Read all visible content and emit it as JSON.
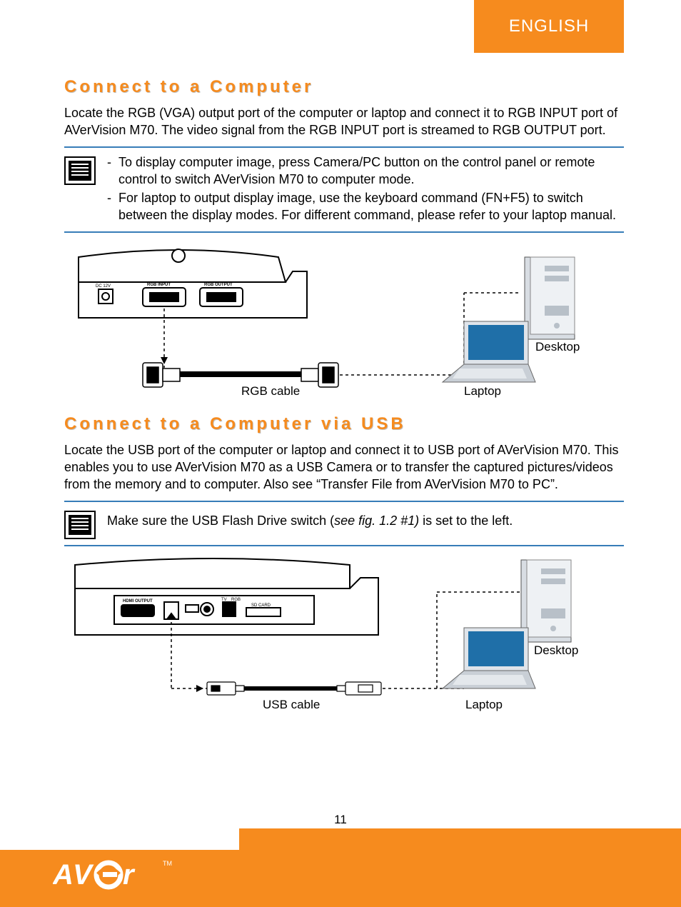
{
  "language_tab": "ENGLISH",
  "section1": {
    "heading": "Connect to a Computer",
    "paragraph": "Locate the RGB (VGA) output port of the computer or laptop and connect it to RGB INPUT port of AVerVision M70. The video signal from the RGB INPUT port is streamed to RGB OUTPUT port.",
    "notes": [
      "To display computer image, press Camera/PC button on the control panel or remote control to switch AVerVision M70 to computer mode.",
      "For laptop to output display image, use the keyboard command (FN+F5) to switch between the display modes. For different command, please refer to your laptop manual."
    ],
    "labels": {
      "rgb_cable": "RGB cable",
      "laptop": "Laptop",
      "desktop": "Desktop",
      "port_left": "RGB INPUT",
      "port_right": "RGB OUTPUT",
      "dc": "DC 12V"
    }
  },
  "section2": {
    "heading": "Connect to a Computer via USB",
    "paragraph": "Locate the USB port of the computer or laptop and connect it to USB port of AVerVision M70. This enables you to use AVerVision M70 as a USB Camera or to transfer the captured pictures/videos from the memory and to computer. Also see “Transfer File from AVerVision M70 to PC”.",
    "note_prefix": "Make sure the USB Flash Drive switch (",
    "note_em": "see fig. 1.2 #1)",
    "note_suffix": " is set to the left.",
    "labels": {
      "usb_cable": "USB cable",
      "laptop": "Laptop",
      "desktop": "Desktop",
      "hdmi": "HDMI OUTPUT",
      "tv": "TV",
      "rgb": "RGB",
      "sd": "SD CARD"
    }
  },
  "page_number": "11",
  "brand": "AVer",
  "trademark": "TM"
}
